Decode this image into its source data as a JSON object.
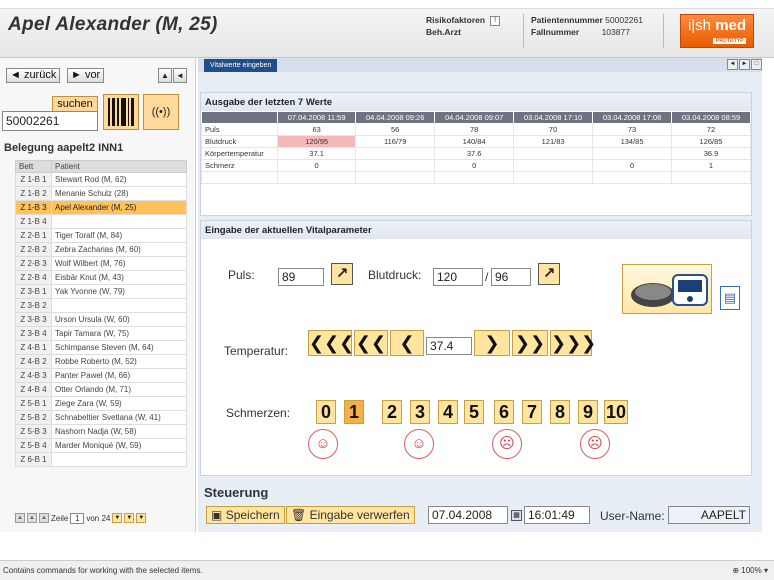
{
  "header": {
    "patient_title": "Apel Alexander (M, 25)",
    "risk_label": "Risikofaktoren",
    "risk_icon": "risk-factor-icon",
    "doc_label": "Beh.Arzt",
    "patient_no_label": "Patientennummer",
    "patient_no": "50002261",
    "case_no_label": "Fallnummer",
    "case_no": "103877",
    "logo_main_a": "i|sh",
    "logo_main_b": "med",
    "logo_sub": "PROTOTYP",
    "brand_color": "#e85c00"
  },
  "left": {
    "back_label": "◄ zurück",
    "forward_label": "► vor",
    "search_label": "suchen",
    "search_value": "50002261",
    "barcode_icon": "barcode-scanner-icon",
    "rfid_icon": "rfid-reader-icon",
    "section_title": "Belegung aapelt2 INN1",
    "table_headers": [
      "Bett",
      "Patient"
    ],
    "beds": [
      {
        "bed": "Z 1-B 1",
        "patient": "Stewart Rod (M, 62)"
      },
      {
        "bed": "Z 1-B 2",
        "patient": "Menanie Schulz (28)"
      },
      {
        "bed": "Z 1-B 3",
        "patient": "Apel Alexander (M, 25)"
      },
      {
        "bed": "Z 1-B 4",
        "patient": ""
      },
      {
        "bed": "Z 2-B 1",
        "patient": "Tiger Toralf (M, 84)"
      },
      {
        "bed": "Z 2-B 2",
        "patient": "Zebra Zacharias (M, 60)"
      },
      {
        "bed": "Z 2-B 3",
        "patient": "Wolf Wilbert (M, 76)"
      },
      {
        "bed": "Z 2-B 4",
        "patient": "Eisbär Knut (M, 43)"
      },
      {
        "bed": "Z 3-B 1",
        "patient": "Yak Yvonne (W, 79)"
      },
      {
        "bed": "Z 3-B 2",
        "patient": ""
      },
      {
        "bed": "Z 3-B 3",
        "patient": "Urson Ursula (W, 60)"
      },
      {
        "bed": "Z 3-B 4",
        "patient": "Tapir Tamara (W, 75)"
      },
      {
        "bed": "Z 4-B 1",
        "patient": "Schimpanse Steven (M, 64)"
      },
      {
        "bed": "Z 4-B 2",
        "patient": "Robbe Roberto (M, 52)"
      },
      {
        "bed": "Z 4-B 3",
        "patient": "Panter Pawel (M, 66)"
      },
      {
        "bed": "Z 4-B 4",
        "patient": "Otter Orlando (M, 71)"
      },
      {
        "bed": "Z 5-B 1",
        "patient": "Ziege Zara (W, 59)"
      },
      {
        "bed": "Z 5-B 2",
        "patient": "Schnabeltier Svetlana (W, 41)"
      },
      {
        "bed": "Z 5-B 3",
        "patient": "Nashorn Nadja (W, 58)"
      },
      {
        "bed": "Z 5-B 4",
        "patient": "Marder Moniqué (W, 59)"
      },
      {
        "bed": "Z 6-B 1",
        "patient": ""
      }
    ],
    "selected_bed": "Z 1-B 3",
    "pager_label": "Zeile",
    "pager_value": "1",
    "pager_total": "von 24"
  },
  "main": {
    "tab_label": "Vitalwerte eingeben",
    "history_title": "Ausgabe der letzten 7 Werte",
    "history_dates": [
      "07.04.2008 11:59",
      "04.04.2008 09:26",
      "04.04.2008 09:07",
      "03.04.2008 17:10",
      "03.04.2008 17:08",
      "03.04.2008 08:59"
    ],
    "history_rows": [
      {
        "label": "Puls",
        "values": [
          "63",
          "56",
          "78",
          "70",
          "73",
          "72"
        ]
      },
      {
        "label": "Blutdruck",
        "values": [
          "120/95",
          "116/79",
          "140/84",
          "121/83",
          "134/85",
          "126/85"
        ]
      },
      {
        "label": "Körpertemperatur",
        "values": [
          "37.1",
          "",
          "37.6",
          "",
          "",
          "36.9"
        ]
      },
      {
        "label": "Schmerz",
        "values": [
          "0",
          "",
          "0",
          "",
          "0",
          "1"
        ]
      }
    ],
    "highlight_color": "#f6b9b9",
    "input_title": "Eingabe der aktuellen Vitalparameter",
    "pulse_label": "Puls:",
    "pulse_value": "89",
    "bp_label": "Blutdruck:",
    "bp_sys": "120",
    "bp_sep": "/",
    "bp_dia": "96",
    "temp_label": "Temperatur:",
    "temp_value": "37.4",
    "pain_label": "Schmerzen:",
    "pain_values": [
      "0",
      "1",
      "2",
      "3",
      "4",
      "5",
      "6",
      "7",
      "8",
      "9",
      "10"
    ],
    "pain_selected": "1",
    "control_title": "Steuerung",
    "save_label": "Speichern",
    "discard_label": "Eingabe verwerfen",
    "date_value": "07.04.2008",
    "time_value": "16:01:49",
    "user_label": "User-Name:",
    "user_value": "AAPELT",
    "device_icon": "blood-pressure-monitor-icon",
    "export_icon": "clipboard-export-icon"
  },
  "status": {
    "text": "Contains commands for working with the selected items.",
    "zoom": "100%"
  }
}
